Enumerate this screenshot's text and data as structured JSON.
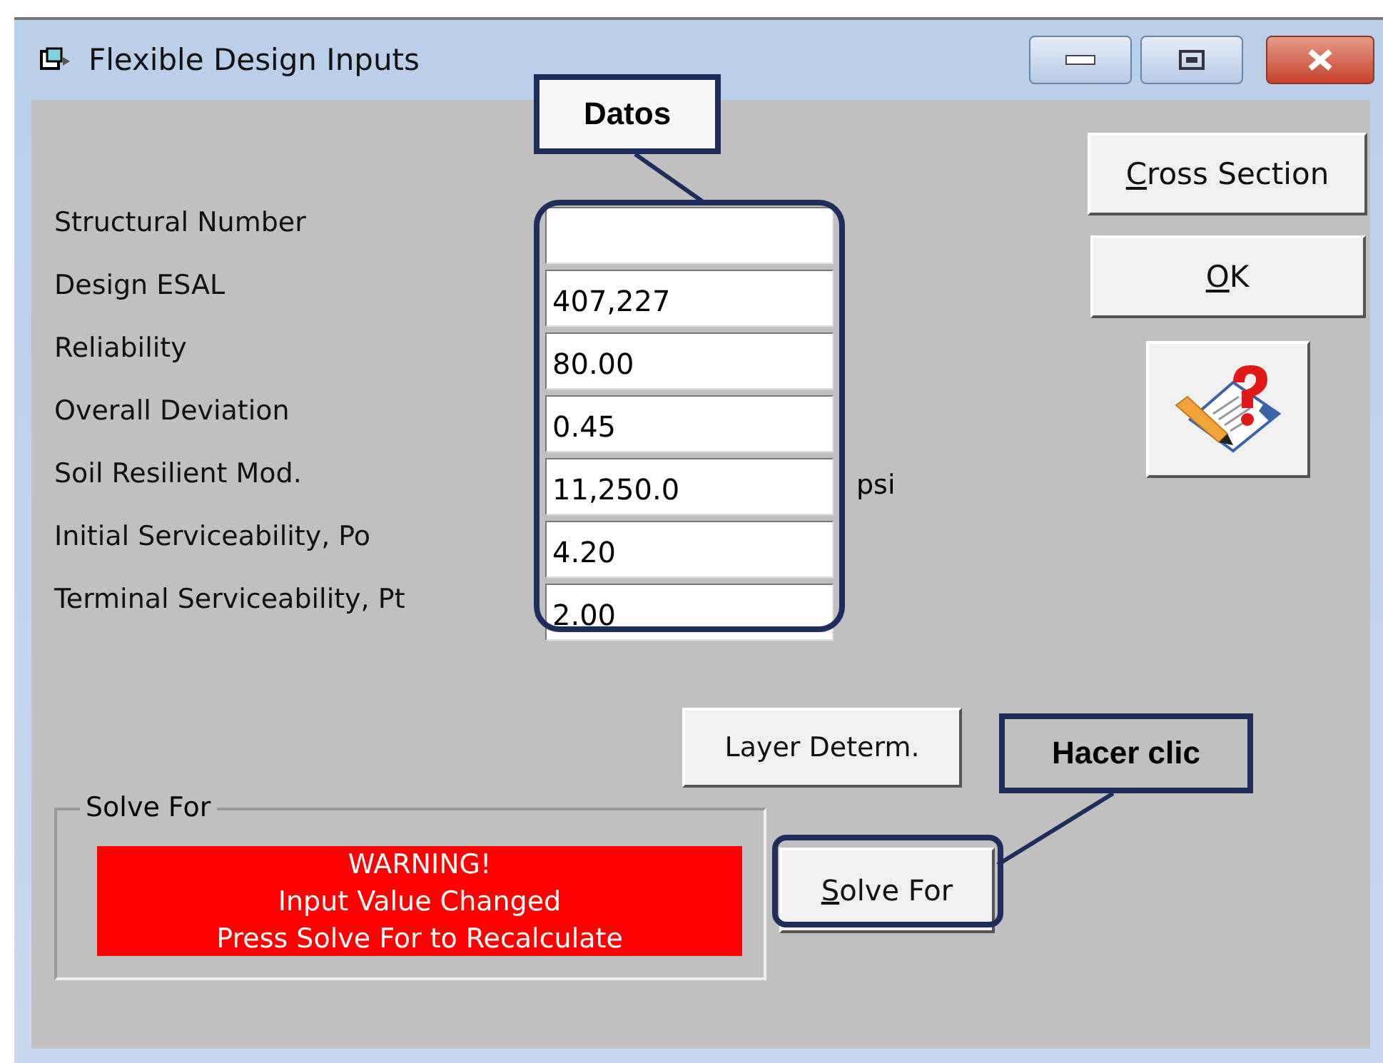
{
  "window": {
    "title": "Flexible Design Inputs"
  },
  "inputs": [
    {
      "label": "Structural Number"
    },
    {
      "label": "Design ESAL",
      "value": "407,227"
    },
    {
      "label": "Reliability",
      "value": "80.00"
    },
    {
      "label": "Overall Deviation",
      "value": "0.45"
    },
    {
      "label": "Soil Resilient Mod.",
      "value": "11,250.0",
      "unit": "psi"
    },
    {
      "label": "Initial Serviceability, Po",
      "value": "4.20"
    },
    {
      "label": "Terminal Serviceability, Pt",
      "value": "2.00"
    }
  ],
  "side_buttons": [
    {
      "label": "Cross Section",
      "underline_first": true
    },
    {
      "label": "OK",
      "underline_first": true
    }
  ],
  "layer_button": {
    "label": "Layer Determ.",
    "underline_first": false
  },
  "solve_group": {
    "title": "Solve For",
    "warning": "WARNING!\nInput Value Changed\nPress Solve For to Recalculate",
    "button": {
      "label": "Solve For",
      "underline_first": true
    }
  },
  "callouts": [
    {
      "text": "Datos"
    },
    {
      "text": "Hacer clic"
    }
  ]
}
